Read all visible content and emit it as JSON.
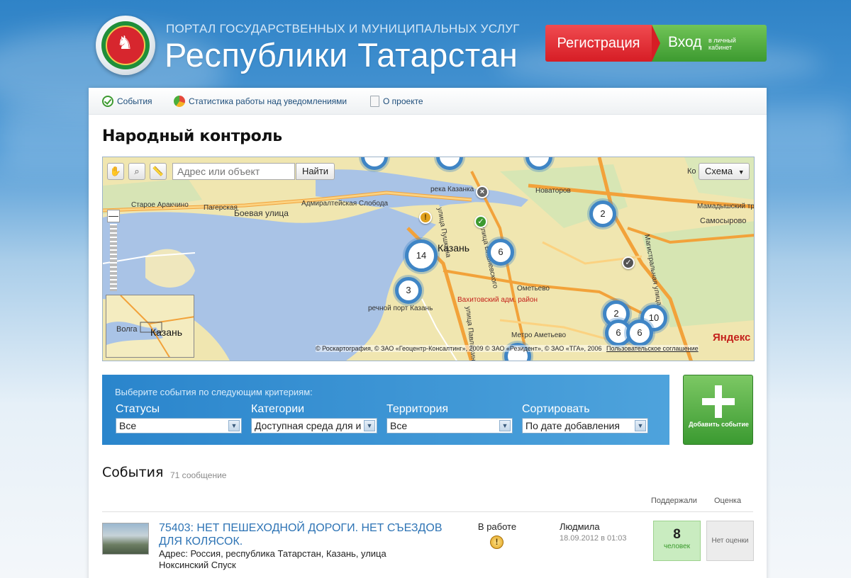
{
  "header": {
    "subtitle": "ПОРТАЛ ГОСУДАРСТВЕННЫХ И МУНИЦИПАЛЬНЫХ УСЛУГ",
    "title": "Республики Татарстан",
    "register": "Регистрация",
    "login": "Вход",
    "login_sub": "в личный кабинет"
  },
  "nav": [
    {
      "label": "События",
      "icon": "check-circle-icon"
    },
    {
      "label": "Статистика работы над уведомлениями",
      "icon": "pie-chart-icon"
    },
    {
      "label": "О проекте",
      "icon": "document-icon"
    }
  ],
  "page_title": "Народный контроль",
  "map": {
    "search_placeholder": "Адрес или объект",
    "search_button": "Найти",
    "layer": "Схема",
    "copyright": "© Роскартография, © ЗАО «Геоцентр-Консалтинг», 2009 © ЗАО «Резидент», © ЗАО «ТГА», 2006",
    "terms": "Пользовательское соглашение",
    "provider": "Яндекс",
    "minimap_city": "Казань",
    "minimap_river": "Волга",
    "city_label": "Казань",
    "clusters": [
      "14",
      "6",
      "3",
      "2",
      "2",
      "10",
      "6",
      "6"
    ],
    "labels": [
      "Старое Аракчино",
      "Пагерская",
      "Боевая улица",
      "Адмиралтейская Слобода",
      "река Казанка",
      "Новаторов",
      "Мамадышский тракт",
      "Самосырово",
      "Казань",
      "улица Вишневского",
      "Ометьево",
      "Вахитовский адм. район",
      "речной порт Казань",
      "Метро Аметьево",
      "улица Павлюхина",
      "Магистральная улица",
      "улица Пушкина",
      "Ко"
    ]
  },
  "filter": {
    "hint": "Выберите события по следующим критериям:",
    "status_label": "Статусы",
    "status_value": "Все",
    "category_label": "Категории",
    "category_value": "Доступная среда для и",
    "territory_label": "Территория",
    "territory_value": "Все",
    "sort_label": "Сортировать",
    "sort_value": "По дате добавления"
  },
  "add_button": "Добавить событие",
  "events": {
    "title": "События",
    "count": "71 сообщение",
    "col_supported": "Поддержали",
    "col_rating": "Оценка",
    "items": [
      {
        "title": "75403: НЕТ ПЕШЕХОДНОЙ ДОРОГИ. НЕТ СЪЕЗДОВ ДЛЯ КОЛЯСОК.",
        "address": "Адрес: Россия, республика Татарстан, Казань, улица Ноксинский Спуск",
        "status": "В работе",
        "author": "Людмила",
        "date": "18.09.2012 в 01:03",
        "supported": "8",
        "supported_unit": "человек",
        "rating": "Нет оценки"
      }
    ]
  },
  "colors": {
    "register": "#d61d25",
    "login": "#3d9a30",
    "accent": "#2e74b5",
    "cluster": "#3f85c5"
  }
}
